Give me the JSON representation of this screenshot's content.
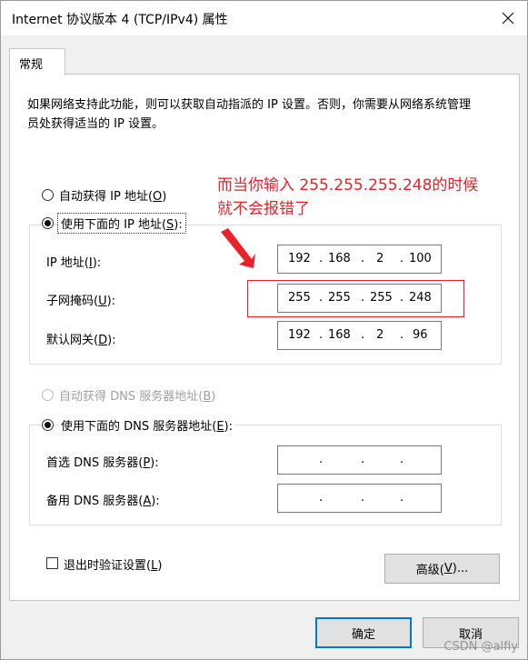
{
  "window": {
    "title": "Internet 协议版本 4 (TCP/IPv4) 属性",
    "close_icon": "close-icon"
  },
  "tabs": [
    {
      "label": "常规"
    }
  ],
  "description": "如果网络支持此功能，则可以获取自动指派的 IP 设置。否则，你需要从网络系统管理员处获得适当的 IP 设置。",
  "ip_section": {
    "auto_label": "自动获得 IP 地址(",
    "auto_key": "O",
    "manual_label": "使用下面的 IP 地址(",
    "manual_key": "S",
    "fields": [
      {
        "label": "IP 地址(",
        "key": "I",
        "octets": [
          "192",
          "168",
          "2",
          "100"
        ]
      },
      {
        "label": "子网掩码(",
        "key": "U",
        "octets": [
          "255",
          "255",
          "255",
          "248"
        ]
      },
      {
        "label": "默认网关(",
        "key": "D",
        "octets": [
          "192",
          "168",
          "2",
          "96"
        ]
      }
    ]
  },
  "dns_section": {
    "auto_label": "自动获得 DNS 服务器地址(",
    "auto_key": "B",
    "manual_label": "使用下面的 DNS 服务器地址(",
    "manual_key": "E",
    "fields": [
      {
        "label": "首选 DNS 服务器(",
        "key": "P",
        "octets": [
          "",
          "",
          "",
          ""
        ]
      },
      {
        "label": "备用 DNS 服务器(",
        "key": "A",
        "octets": [
          "",
          "",
          "",
          ""
        ]
      }
    ]
  },
  "validate_label": "退出时验证设置(",
  "validate_key": "L",
  "advanced_label": "高级(",
  "advanced_key": "V",
  "ok_label": "确定",
  "cancel_label": "取消",
  "annotation": {
    "line1": "而当你输入 255.255.255.248的时候",
    "line2": "就不会报错了"
  },
  "watermark": "CSDN @alfiy",
  "colors": {
    "annotation": "#e8212b",
    "default_button_border": "#0078d7"
  }
}
